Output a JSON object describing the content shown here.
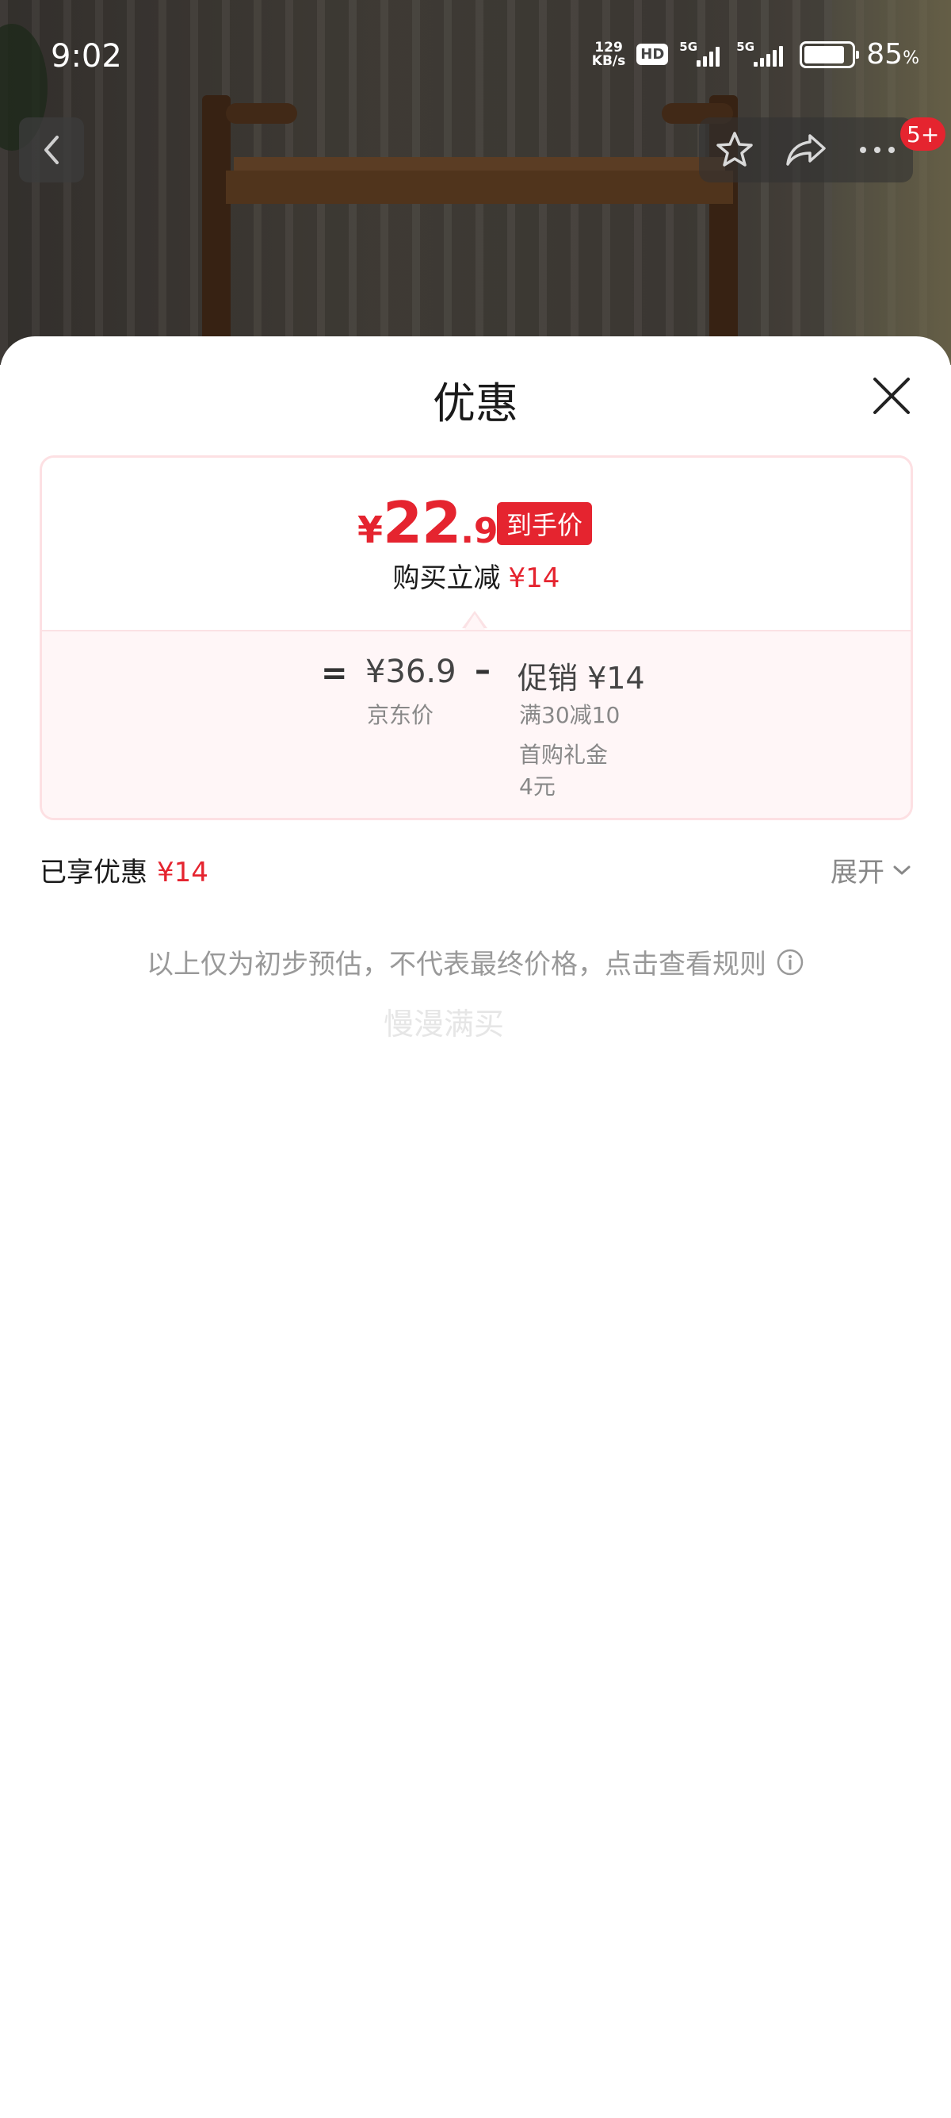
{
  "status_bar": {
    "time": "9:02",
    "net_speed_value": "129",
    "net_speed_unit": "KB/s",
    "hd_badge": "HD",
    "signal1_label": "5G",
    "signal2_label": "5G",
    "battery_percent": "85",
    "battery_unit": "%",
    "battery_level": 0.85
  },
  "nav": {
    "back_icon": "chevron-left-icon",
    "favorite_icon": "star-icon",
    "share_icon": "share-icon",
    "more_icon": "more-icon",
    "notification_badge": "5+"
  },
  "sheet": {
    "title": "优惠",
    "close_icon": "close-icon",
    "final_price_currency": "¥",
    "final_price_integer": "22",
    "final_price_decimal": ".9",
    "final_price_tag": "到手价",
    "instant_cut_label": "购买立减",
    "instant_cut_amount": "¥14",
    "breakdown": {
      "equals": "=",
      "base_price": "¥36.9",
      "base_label": "京东价",
      "minus": "–",
      "promo_title": "促销 ¥14",
      "promo_detail": "满30减10",
      "gift_title": "首购礼金",
      "gift_amount": "4元"
    },
    "enjoyed_label": "已享优惠",
    "enjoyed_amount": "¥14",
    "expand_label": "展开",
    "disclaimer": "以上仅为初步预估，不代表最终价格，点击查看规则",
    "watermark": "慢漫满买"
  },
  "colors": {
    "accent_red": "#e5242f",
    "card_border": "#fde0e3",
    "card_bottom_bg": "#fff6f7"
  }
}
